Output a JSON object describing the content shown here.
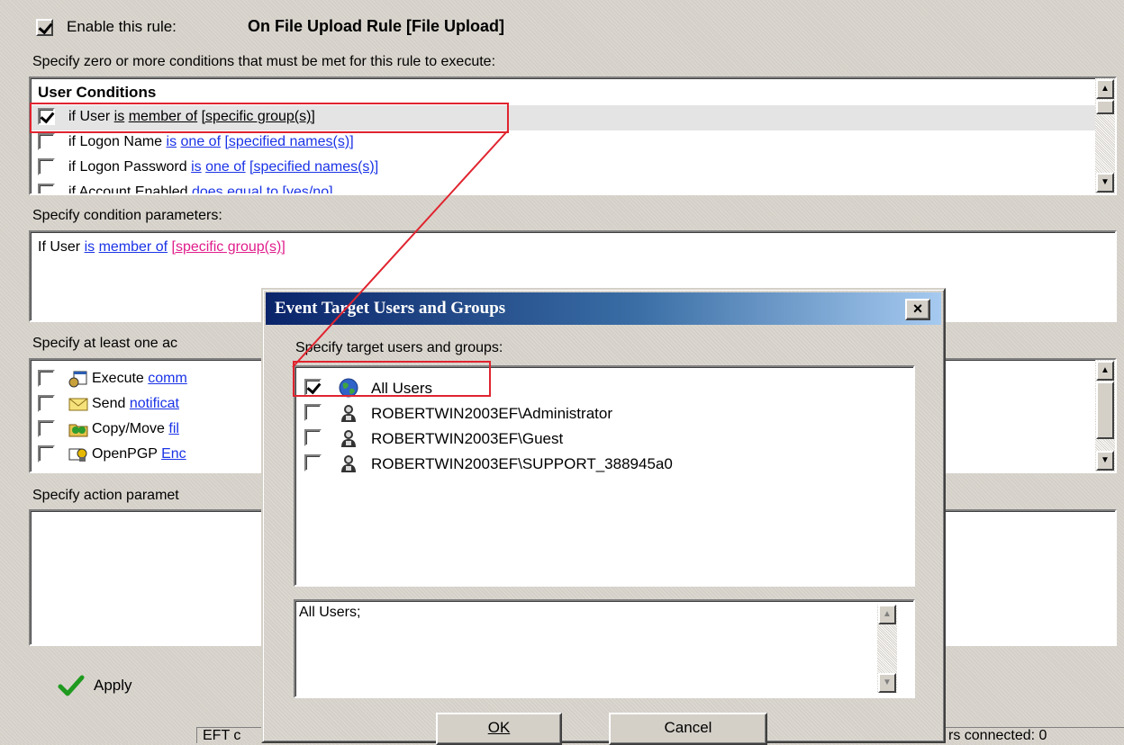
{
  "rule": {
    "enable_label": "Enable this rule:",
    "enabled": true,
    "name": "On File Upload Rule [File Upload]"
  },
  "conditions": {
    "prompt": "Specify zero or more conditions that must be met for this rule to execute:",
    "header": "User Conditions",
    "items": [
      {
        "checked": true,
        "pre": "if User ",
        "verb": "is",
        "mid": " ",
        "op": "member of",
        "post": " ",
        "arg": "[specific group(s)]"
      },
      {
        "checked": false,
        "pre": "if Logon Name ",
        "verb": "is",
        "mid": " ",
        "op": "one of",
        "post": " ",
        "arg": "[specified names(s)]"
      },
      {
        "checked": false,
        "pre": "if Logon Password ",
        "verb": "is",
        "mid": " ",
        "op": "one of",
        "post": " ",
        "arg": "[specified names(s)]"
      },
      {
        "checked": false,
        "pre": "if Account Enabled ",
        "verb": "does equal to",
        "mid": " ",
        "op": "[yes/no]",
        "post": "",
        "arg": ""
      }
    ]
  },
  "condition_params": {
    "prompt": "Specify condition parameters:",
    "pre": "If User ",
    "verb": "is",
    "op": "member of",
    "arg": "[specific group(s)]"
  },
  "actions": {
    "prompt": "Specify at least one ac",
    "items": [
      {
        "checked": false,
        "icon": "execute-icon",
        "pre": "Execute ",
        "link": "comm"
      },
      {
        "checked": false,
        "icon": "envelope-icon",
        "pre": "Send ",
        "link": "notificat"
      },
      {
        "checked": false,
        "icon": "copy-move-icon",
        "pre": "Copy/Move ",
        "link": "fil"
      },
      {
        "checked": false,
        "icon": "openpgp-icon",
        "pre": "OpenPGP ",
        "link": "Enc"
      }
    ]
  },
  "action_params": {
    "prompt": "Specify action paramet"
  },
  "apply_label": "Apply",
  "status_left": "EFT c",
  "status_right": "rs connected: 0",
  "dialog": {
    "title": "Event Target Users and Groups",
    "close_glyph": "×",
    "prompt": "Specify target users and groups:",
    "users": [
      {
        "checked": true,
        "icon": "globe-icon",
        "name": "All Users"
      },
      {
        "checked": false,
        "icon": "user-icon",
        "name": "ROBERTWIN2003EF\\Administrator"
      },
      {
        "checked": false,
        "icon": "user-icon",
        "name": "ROBERTWIN2003EF\\Guest"
      },
      {
        "checked": false,
        "icon": "user-icon",
        "name": "ROBERTWIN2003EF\\SUPPORT_388945a0"
      }
    ],
    "selection_text": "All Users;",
    "ok_label": "OK",
    "cancel_label": "Cancel"
  },
  "colors": {
    "highlight": "#e0242f",
    "link": "#1a33e6",
    "param": "#e01e8c",
    "title_bar": "#0a246a"
  }
}
